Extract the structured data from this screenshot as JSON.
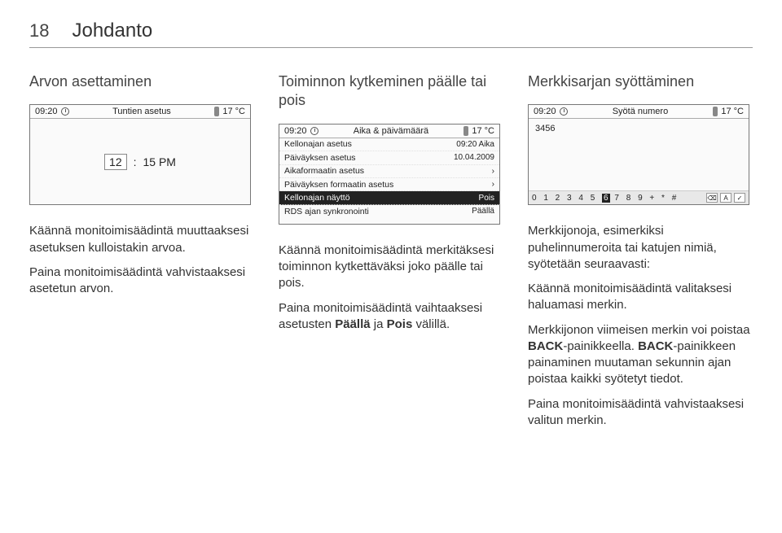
{
  "header": {
    "page_number": "18",
    "section": "Johdanto"
  },
  "columns": [
    {
      "heading": "Arvon asettaminen"
    },
    {
      "heading": "Toiminnon kytkeminen päälle tai pois"
    },
    {
      "heading": "Merkkisarjan syöttäminen"
    }
  ],
  "screens": {
    "common": {
      "time": "09:20",
      "temp": "17 °C"
    },
    "s1": {
      "title": "Tuntien asetus",
      "hours": "12",
      "colon": ":",
      "mins_pm": "15 PM"
    },
    "s2": {
      "title": "Aika & päivämäärä",
      "rows": [
        {
          "label": "Kellonajan asetus",
          "value": "09:20 Aika",
          "hl": false
        },
        {
          "label": "Päiväyksen asetus",
          "value": "10.04.2009",
          "hl": false
        },
        {
          "label": "Aikaformaatin asetus",
          "value": "›",
          "hl": false
        },
        {
          "label": "Päiväyksen formaatin asetus",
          "value": "›",
          "hl": false
        },
        {
          "label": "Kellonajan näyttö",
          "value": "Pois",
          "hl": true
        },
        {
          "label": "RDS ajan synkronointi",
          "value": "Päällä",
          "hl": false
        }
      ]
    },
    "s3": {
      "title": "Syötä numero",
      "entered": "3456",
      "strip_left": "0 1 2 3 4 5",
      "strip_highlight": "6",
      "strip_right": "7 8 9 + * #"
    }
  },
  "body": {
    "col1": [
      "Käännä monitoimisäädintä muuttaaksesi asetuksen kulloistakin arvoa.",
      "Paina monitoimisäädintä vahvistaaksesi asetetun arvon."
    ],
    "col2": [
      "Käännä monitoimisäädintä merkitäksesi toiminnon kytkettäväksi joko päälle tai pois.",
      {
        "pre": "Paina monitoimisäädintä vaihtaaksesi asetusten ",
        "b1": "Päällä",
        "mid": " ja ",
        "b2": "Pois",
        "post": " välillä."
      }
    ],
    "col3": [
      "Merkkijonoja, esimerkiksi puhelinnumeroita tai katujen nimiä, syötetään seuraavasti:",
      "Käännä monitoimisäädintä valitaksesi haluamasi merkin.",
      {
        "pre": "Merkkijonon viimeisen merkin voi poistaa ",
        "b1": "BACK",
        "mid": "-painikkeella. ",
        "b2": "BACK",
        "post": "-painikkeen painaminen muutaman sekunnin ajan poistaa kaikki syötetyt tiedot."
      },
      "Paina monitoimisäädintä vahvistaaksesi valitun merkin."
    ]
  }
}
